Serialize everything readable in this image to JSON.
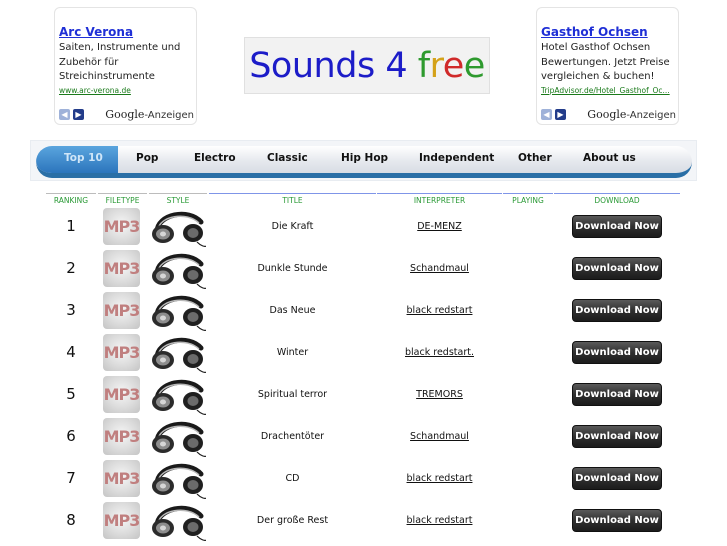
{
  "ads": [
    {
      "title": "Arc Verona",
      "lines": [
        "Saiten, Instrumente und",
        "Zubehör für",
        "Streichinstrumente"
      ],
      "url": "www.arc-verona.de",
      "brand": "Google",
      "brand_suffix": "-Anzeigen"
    },
    {
      "title": "Gasthof Ochsen",
      "lines": [
        "Hotel Gasthof Ochsen",
        "Bewertungen. Jetzt Preise",
        "vergleichen & buchen!"
      ],
      "url": "TripAdvisor.de/Hotel_Gasthof_Oc...",
      "brand": "Google",
      "brand_suffix": "-Anzeigen"
    }
  ],
  "logo": {
    "text": "Sounds 4 free",
    "letters": [
      "S",
      "o",
      "u",
      "n",
      "d",
      "s",
      " ",
      "4",
      " ",
      "f",
      "r",
      "e",
      "e"
    ],
    "letter_colors": [
      "#1c1cc8",
      "#1c1cc8",
      "#1c1cc8",
      "#1c1cc8",
      "#1c1cc8",
      "#1c1cc8",
      "#1c1cc8",
      "#1c1cc8",
      "#1c1cc8",
      "#2e9a2e",
      "#d4a21a",
      "#d02a2a",
      "#2e9a2e"
    ]
  },
  "nav": {
    "items": [
      "Top 10",
      "Pop",
      "Electro",
      "Classic",
      "Hip Hop",
      "Independent",
      "Other",
      "About us"
    ],
    "active_index": 0
  },
  "table": {
    "headers": {
      "ranking": "RANKING",
      "filetype": "FILETYPE",
      "style": "STYLE",
      "title": "TITLE",
      "interpreter": "INTERPRETER",
      "playing": "PLAYING",
      "download": "DOWNLOAD"
    },
    "filetype_label": "MP3",
    "rows": [
      {
        "rank": "1",
        "title": "Die Kraft",
        "interpreter": "DE-MENZ",
        "download": "Download Now"
      },
      {
        "rank": "2",
        "title": "Dunkle Stunde",
        "interpreter": "Schandmaul",
        "download": "Download Now"
      },
      {
        "rank": "3",
        "title": "Das Neue",
        "interpreter": "black redstart",
        "download": "Download Now"
      },
      {
        "rank": "4",
        "title": "Winter",
        "interpreter": "black redstart.",
        "download": "Download Now"
      },
      {
        "rank": "5",
        "title": "Spiritual terror",
        "interpreter": "TREMORS",
        "download": "Download Now"
      },
      {
        "rank": "6",
        "title": "Drachentöter",
        "interpreter": "Schandmaul",
        "download": "Download Now"
      },
      {
        "rank": "7",
        "title": "CD",
        "interpreter": "black redstart",
        "download": "Download Now"
      },
      {
        "rank": "8",
        "title": "Der große Rest",
        "interpreter": "black redstart",
        "download": "Download Now"
      }
    ]
  },
  "colors": {
    "ad_link": "#1f2fd6",
    "header_text": "#2a9a36",
    "nav_accent": "#2a6fa6"
  }
}
